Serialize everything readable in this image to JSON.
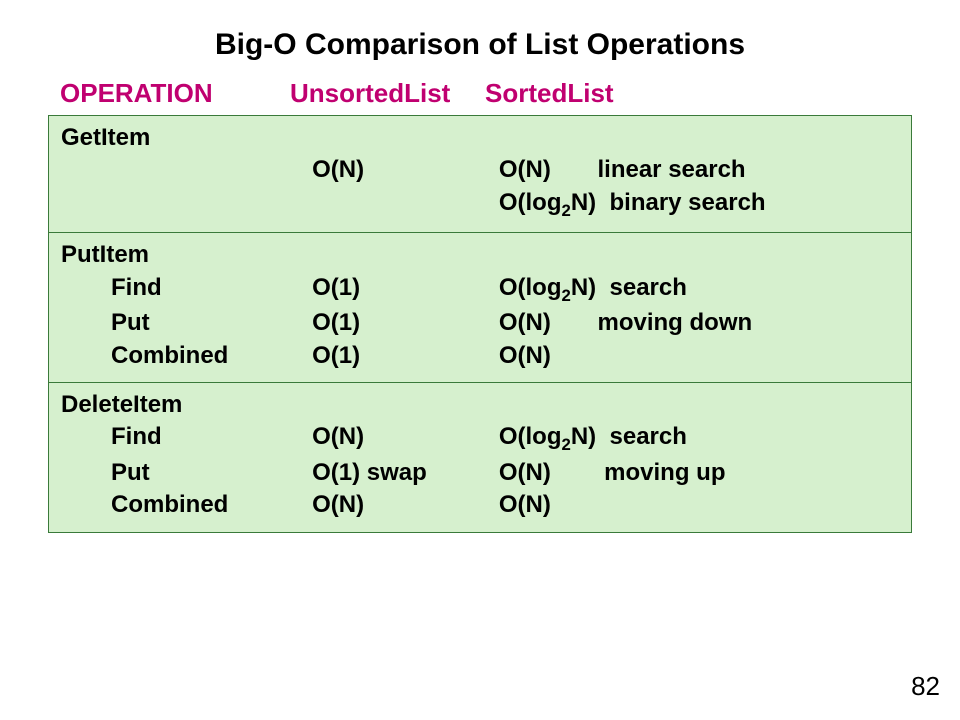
{
  "title": "Big-O Comparison of List Operations",
  "headers": {
    "operation": "OPERATION",
    "unsorted": "UnsortedList",
    "sorted": "SortedList"
  },
  "sections": {
    "getitem": {
      "name": "GetItem",
      "rows": [
        {
          "label": "",
          "unsorted": "O(N)",
          "sorted": "O(N)       linear search"
        },
        {
          "label": "",
          "unsorted": "",
          "sorted": "O(log₂N)  binary search"
        }
      ]
    },
    "putitem": {
      "name": "PutItem",
      "rows": [
        {
          "label": "Find",
          "unsorted": "O(1)",
          "sorted": "O(log₂N)  search"
        },
        {
          "label": "Put",
          "unsorted": "O(1)",
          "sorted": "O(N)       moving down"
        },
        {
          "label": "Combined",
          "unsorted": "O(1)",
          "sorted": "O(N)"
        }
      ]
    },
    "deleteitem": {
      "name": "DeleteItem",
      "rows": [
        {
          "label": "Find",
          "unsorted": "O(N)",
          "sorted": "O(log₂N)  search"
        },
        {
          "label": "Put",
          "unsorted": "O(1) swap",
          "sorted": "O(N)        moving up"
        },
        {
          "label": "Combined",
          "unsorted": "O(N)",
          "sorted": "O(N)"
        }
      ]
    }
  },
  "page_number": "82",
  "chart_data": {
    "type": "table",
    "title": "Big-O Comparison of List Operations",
    "columns": [
      "OPERATION",
      "UnsortedList",
      "SortedList"
    ],
    "rows": [
      [
        "GetItem",
        "O(N)",
        "O(N) linear search / O(log2 N) binary search"
      ],
      [
        "PutItem - Find",
        "O(1)",
        "O(log2 N) search"
      ],
      [
        "PutItem - Put",
        "O(1)",
        "O(N) moving down"
      ],
      [
        "PutItem - Combined",
        "O(1)",
        "O(N)"
      ],
      [
        "DeleteItem - Find",
        "O(N)",
        "O(log2 N) search"
      ],
      [
        "DeleteItem - Put",
        "O(1) swap",
        "O(N) moving up"
      ],
      [
        "DeleteItem - Combined",
        "O(N)",
        "O(N)"
      ]
    ]
  }
}
